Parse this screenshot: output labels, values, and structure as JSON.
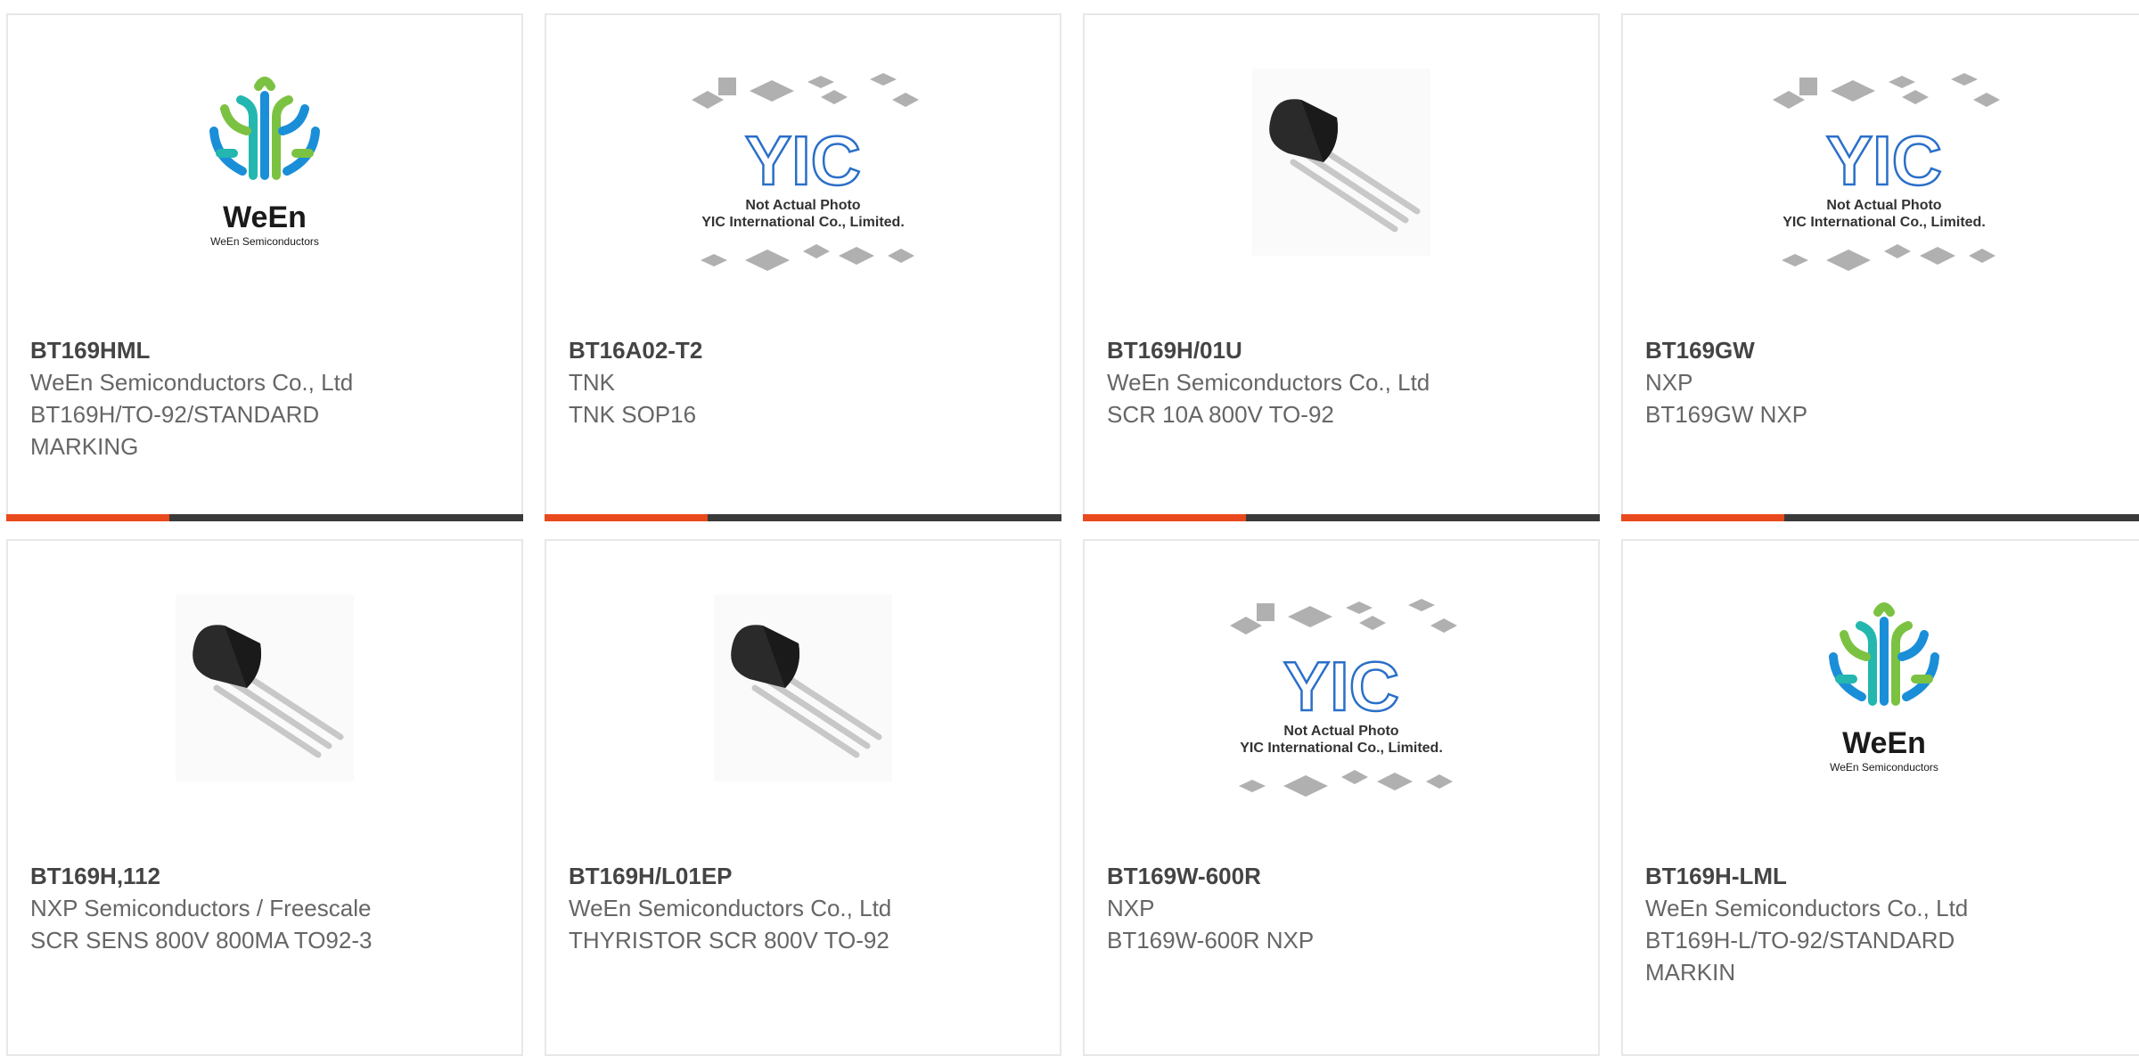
{
  "products": [
    {
      "part": "BT169HML",
      "maker": "WeEn Semiconductors Co., Ltd",
      "desc1": "BT169H/TO-92/STANDARD",
      "desc2": "MARKING",
      "image": "ween-logo"
    },
    {
      "part": "BT16A02-T2",
      "maker": "TNK",
      "desc1": "TNK SOP16",
      "desc2": "",
      "image": "not-actual-photo"
    },
    {
      "part": "BT169H/01U",
      "maker": "WeEn Semiconductors Co., Ltd",
      "desc1": "SCR 10A 800V TO-92",
      "desc2": "",
      "image": "to92-transistor"
    },
    {
      "part": "BT169GW",
      "maker": "NXP",
      "desc1": "BT169GW NXP",
      "desc2": "",
      "image": "not-actual-photo"
    },
    {
      "part": "BT169H,112",
      "maker": "NXP Semiconductors / Freescale",
      "desc1": "SCR SENS 800V 800MA TO92-3",
      "desc2": "",
      "image": "to92-transistor"
    },
    {
      "part": "BT169H/L01EP",
      "maker": "WeEn Semiconductors Co., Ltd",
      "desc1": "THYRISTOR SCR 800V TO-92",
      "desc2": "",
      "image": "to92-transistor"
    },
    {
      "part": "BT169W-600R",
      "maker": "NXP",
      "desc1": "BT169W-600R NXP",
      "desc2": "",
      "image": "not-actual-photo"
    },
    {
      "part": "BT169H-LML",
      "maker": "WeEn Semiconductors Co., Ltd",
      "desc1": "BT169H-L/TO-92/STANDARD",
      "desc2": "MARKIN",
      "image": "ween-logo"
    }
  ],
  "logo": {
    "brand": "WeEn",
    "sub": "WeEn Semiconductors"
  },
  "placeholder": {
    "line1": "Not Actual Photo",
    "line2": "YIC International Co., Limited.",
    "mark": "YIC"
  },
  "colors": {
    "accent": "#e8491d",
    "bar": "#3a3a3a",
    "ween_blue": "#1a8fd8",
    "ween_green": "#7cc242",
    "ween_teal": "#23b7b0"
  }
}
